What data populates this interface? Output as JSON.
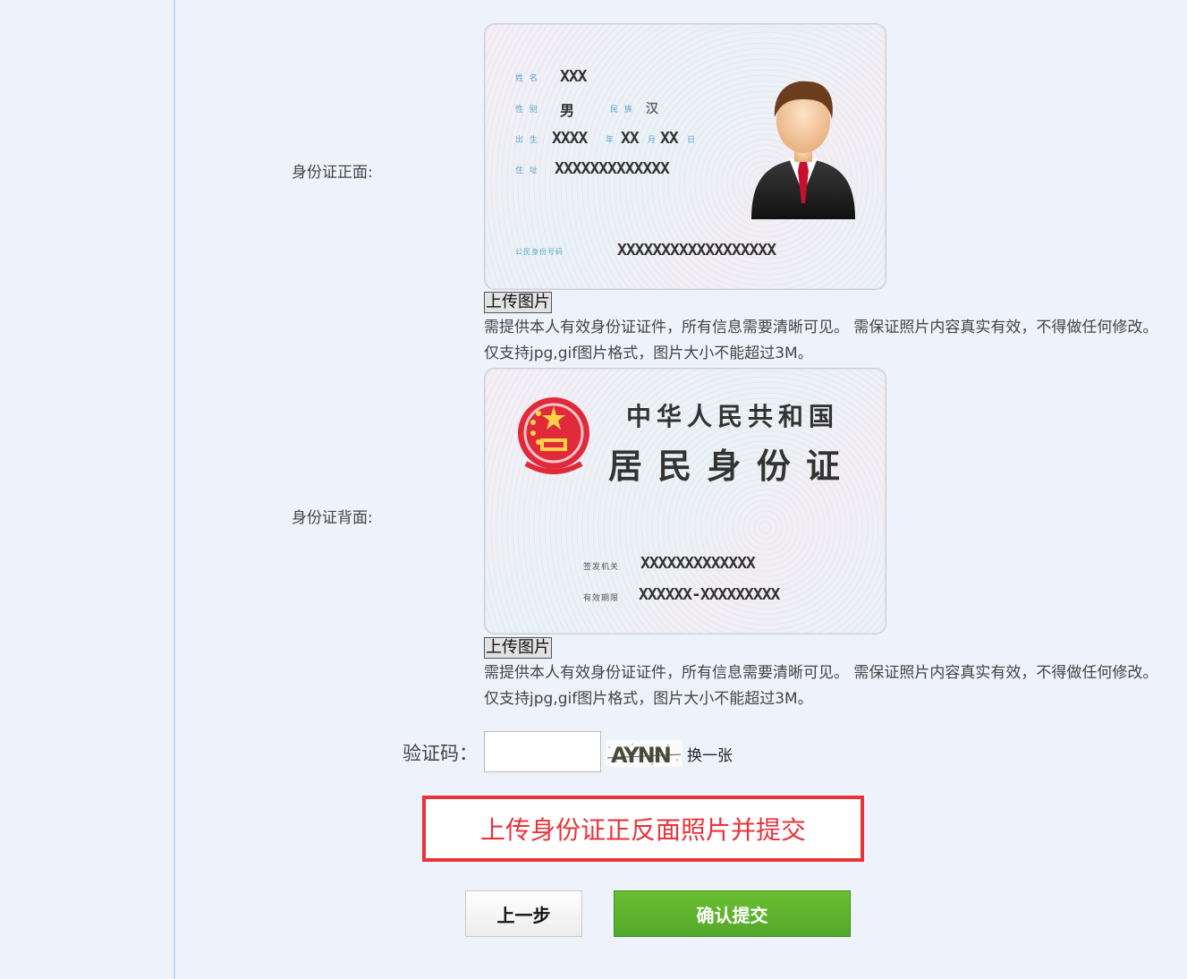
{
  "front": {
    "label": "身份证正面:",
    "card": {
      "name_label": "姓 名",
      "name_value": "XXX",
      "sex_label": "性 别",
      "sex_value": "男",
      "ethnicity_label": "民 族",
      "ethnicity_value": "汉",
      "birth_label": "出 生",
      "birth_year": "XXXX",
      "birth_year_unit": "年",
      "birth_month": "XX",
      "birth_month_unit": "月",
      "birth_day": "XX",
      "birth_day_unit": "日",
      "address_label": "住 址",
      "address_value": "XXXXXXXXXXXXX",
      "id_label": "公民身份号码",
      "id_value": "XXXXXXXXXXXXXXXXXX"
    },
    "upload_label": "上传图片",
    "hint": "需提供本人有效身份证证件，所有信息需要清晰可见。 需保证照片内容真实有效，不得做任何修改。 仅支持jpg,gif图片格式，图片大小不能超过3M。"
  },
  "back": {
    "label": "身份证背面:",
    "card": {
      "country": "中华人民共和国",
      "title": "居 民 身 份 证",
      "authority_label": "签发机关",
      "authority_value": "XXXXXXXXXXXXX",
      "validity_label": "有效期限",
      "validity_value": "XXXXXX-XXXXXXXXX"
    },
    "upload_label": "上传图片",
    "hint": "需提供本人有效身份证证件，所有信息需要清晰可见。 需保证照片内容真实有效，不得做任何修改。 仅支持jpg,gif图片格式，图片大小不能超过3M。"
  },
  "captcha": {
    "label": "验证码：",
    "input_value": "",
    "image_text": "AYNN",
    "refresh_label": "换一张"
  },
  "annotation": {
    "text": "上传身份证正反面照片并提交",
    "color": "#e8333a"
  },
  "buttons": {
    "prev_label": "上一步",
    "submit_label": "确认提交",
    "submit_color": "#5aae2c"
  }
}
